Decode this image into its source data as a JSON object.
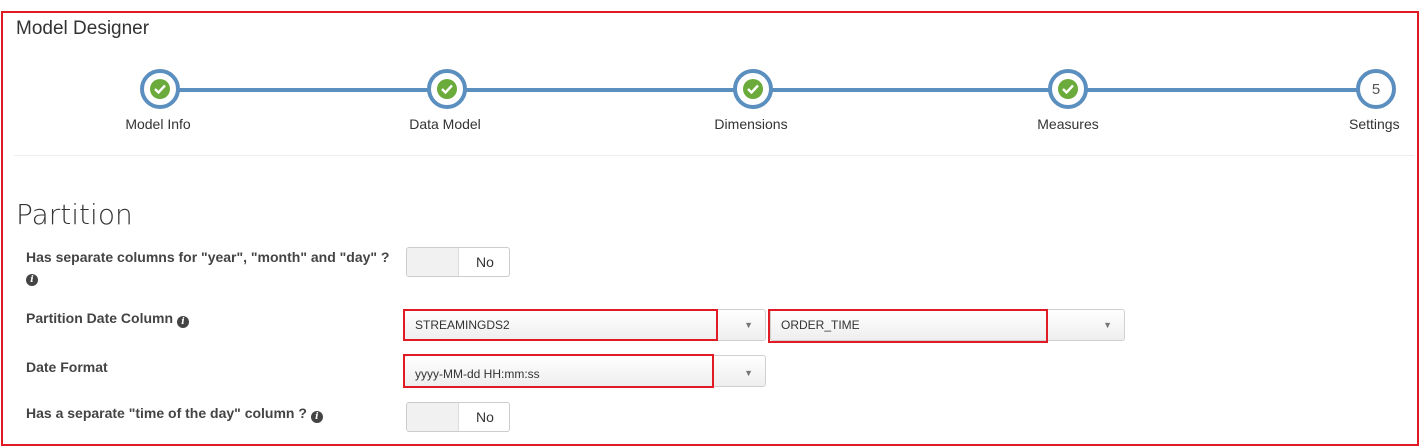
{
  "app": {
    "title": "Model Designer"
  },
  "wizard": {
    "steps": [
      {
        "label": "Model Info",
        "status": "done"
      },
      {
        "label": "Data Model",
        "status": "done"
      },
      {
        "label": "Dimensions",
        "status": "done"
      },
      {
        "label": "Measures",
        "status": "done"
      },
      {
        "label": "Settings",
        "status": "current",
        "number": "5"
      }
    ]
  },
  "partition": {
    "title": "Partition",
    "separate_columns": {
      "label": "Has separate columns for \"year\", \"month\" and \"day\" ?",
      "value": "No"
    },
    "date_column": {
      "label": "Partition Date Column",
      "table": "STREAMINGDS2",
      "column": "ORDER_TIME"
    },
    "date_format": {
      "label": "Date Format",
      "value": "yyyy-MM-dd HH:mm:ss"
    },
    "time_of_day": {
      "label": "Has a separate \"time of the day\" column ?",
      "value": "No"
    }
  },
  "colors": {
    "accent": "#5b8fbf",
    "check": "#6aab3b",
    "highlight": "#e01b24"
  }
}
